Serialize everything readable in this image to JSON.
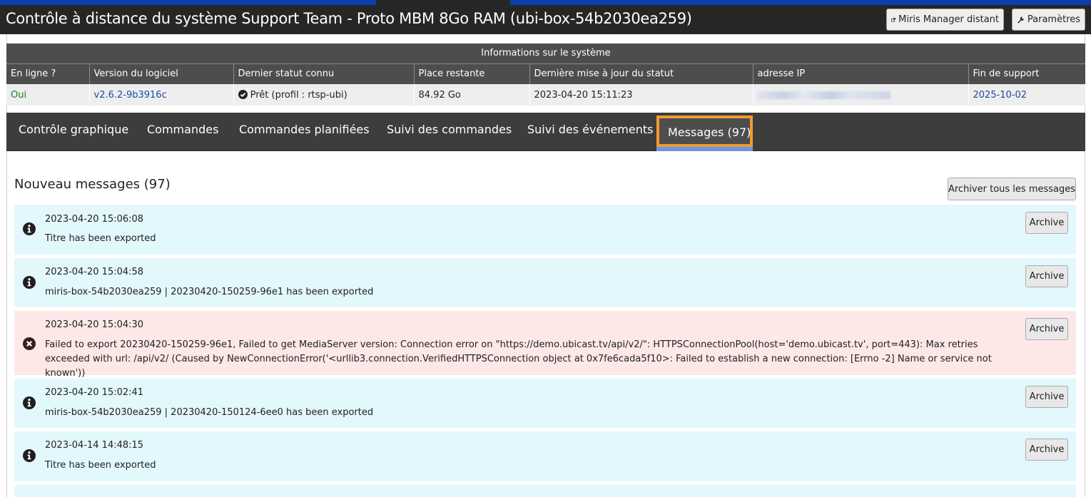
{
  "header": {
    "title": "Contrôle à distance du système Support Team - Proto MBM 8Go RAM (ubi-box-54b2030ea259)",
    "remote_button": "Miris Manager distant",
    "settings_button": "Paramètres"
  },
  "system_info": {
    "caption": "Informations sur le système",
    "columns": [
      "En ligne ?",
      "Version du logiciel",
      "Dernier statut connu",
      "Place restante",
      "Dernière mise à jour du statut",
      "adresse IP",
      "Fin de support"
    ],
    "online": "Oui",
    "version": "v2.6.2-9b3916c",
    "status": "Prêt (profil : rtsp-ubi)",
    "space": "84.92 Go",
    "last_update": "2023-04-20 15:11:23",
    "ip": "",
    "end_of_support": "2025-10-02"
  },
  "tabs": [
    {
      "label": "Contrôle graphique"
    },
    {
      "label": "Commandes"
    },
    {
      "label": "Commandes planifiées"
    },
    {
      "label": "Suivi des commandes"
    },
    {
      "label": "Suivi des événements"
    },
    {
      "label": "Messages (97)"
    }
  ],
  "messages_section": {
    "title": "Nouveau messages (97)",
    "archive_all_label": "Archiver tous les messages",
    "archive_label": "Archive"
  },
  "messages": [
    {
      "type": "info",
      "date": "2023-04-20 15:06:08",
      "text": "Titre has been exported"
    },
    {
      "type": "info",
      "date": "2023-04-20 15:04:58",
      "text": "miris-box-54b2030ea259 | 20230420-150259-96e1 has been exported"
    },
    {
      "type": "error",
      "date": "2023-04-20 15:04:30",
      "text": "Failed to export 20230420-150259-96e1, Failed to get MediaServer version: Connection error on \"https://demo.ubicast.tv/api/v2/\": HTTPSConnectionPool(host='demo.ubicast.tv', port=443): Max retries exceeded with url: /api/v2/ (Caused by NewConnectionError('<urllib3.connection.VerifiedHTTPSConnection object at 0x7fe6cada5f10>: Failed to establish a new connection: [Errno -2] Name or service not known'))"
    },
    {
      "type": "info",
      "date": "2023-04-20 15:02:41",
      "text": "miris-box-54b2030ea259 | 20230420-150124-6ee0 has been exported"
    },
    {
      "type": "info",
      "date": "2023-04-14 14:48:15",
      "text": "Titre has been exported"
    }
  ],
  "colors": {
    "accent_blue": "#0a3fae",
    "active_tab_border": "#f29a2e",
    "info_bg": "#e3f8fc",
    "error_bg": "#fde8e8",
    "online_green": "#1a7f1a",
    "link_blue": "#1a4aa8"
  }
}
